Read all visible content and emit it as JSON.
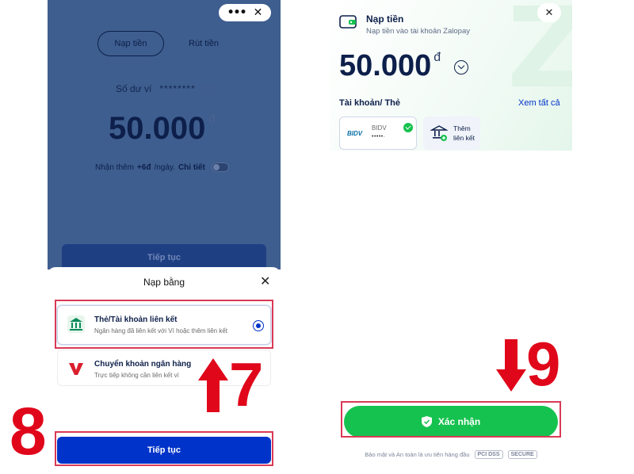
{
  "left_screen": {
    "menu": {
      "more_icon": "•••",
      "close_icon": "✕"
    },
    "tabs": [
      "Nạp tiền",
      "Rút tiền"
    ],
    "balance_label": "Số dư ví",
    "balance_mask": "********",
    "amount": "50.000",
    "currency": "đ",
    "reward": {
      "prefix": "Nhận thêm",
      "value": "+6đ",
      "suffix": "/ngày.",
      "link": "Chi tiết"
    },
    "continue_label": "Tiếp tục",
    "sheet": {
      "title": "Nạp bằng",
      "options": [
        {
          "title": "Thẻ/Tài khoản liên kết",
          "subtitle": "Ngân hàng đã liên kết với Ví hoặc thêm liên kết"
        },
        {
          "title": "Chuyển khoản ngân hàng",
          "subtitle": "Trực tiếp không cần liên kết ví"
        }
      ],
      "continue_label": "Tiếp tục"
    }
  },
  "right_screen": {
    "title": "Nạp tiền",
    "subtitle": "Nạp tiền vào tài khoản Zalopay",
    "amount": "50.000",
    "currency": "đ",
    "accounts_label": "Tài khoản/ Thẻ",
    "see_all": "Xem tất cả",
    "bank_card": {
      "logo": "BIDV",
      "name": "BIDV",
      "mask": "•••••·"
    },
    "add_card": "Thêm liên kết",
    "confirm_label": "Xác nhận",
    "footer": "Bảo mật và An toàn là ưu tiên hàng đầu",
    "footer_badges": [
      "PCI DSS",
      "SECURE"
    ]
  },
  "annotations": {
    "step7": "7",
    "step8": "8",
    "step9": "9"
  },
  "colors": {
    "primary_blue": "#0033c9",
    "green": "#16c24f",
    "highlight_red": "#d93a55",
    "annotation_red": "#e0071b"
  }
}
